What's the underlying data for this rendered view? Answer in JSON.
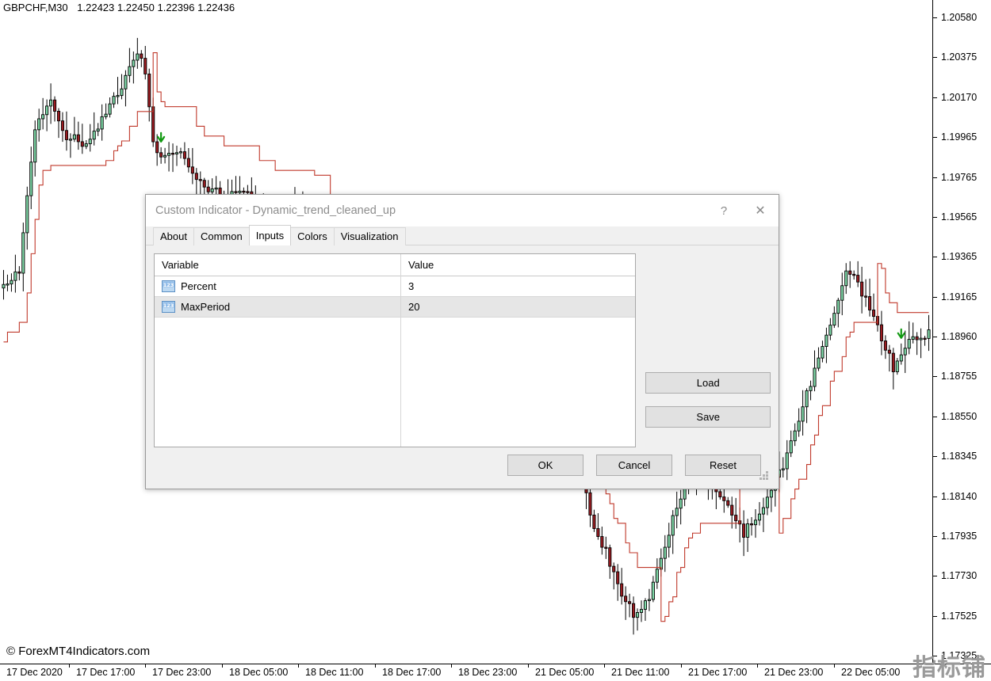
{
  "chart": {
    "symbol_header": "GBPCHF,M30",
    "ohlc": "1.22423 1.22450 1.22396 1.22436",
    "copyright": "© ForexMT4Indicators.com",
    "watermark": "指标铺",
    "colors": {
      "bull_body": "#7fd9a8",
      "bull_border": "#000000",
      "bear_body": "#9b1c21",
      "bear_border": "#000000",
      "indicator_line": "#c0392b",
      "arrow": "#119911",
      "axis": "#000000",
      "background": "#ffffff"
    },
    "price_axis": {
      "ticks": [
        "1.20580",
        "1.20375",
        "1.20170",
        "1.19965",
        "1.19765",
        "1.19565",
        "1.19365",
        "1.19165",
        "1.18960",
        "1.18755",
        "1.18550",
        "1.18345",
        "1.18140",
        "1.17935",
        "1.17730",
        "1.17525",
        "1.17325"
      ],
      "max": 1.2058,
      "min": 1.17325
    },
    "time_axis": {
      "ticks": [
        "17 Dec 2020",
        "17 Dec 17:00",
        "17 Dec 23:00",
        "18 Dec 05:00",
        "18 Dec 11:00",
        "18 Dec 17:00",
        "18 Dec 23:00",
        "21 Dec 05:00",
        "21 Dec 11:00",
        "21 Dec 17:00",
        "21 Dec 23:00",
        "22 Dec 05:00"
      ]
    }
  },
  "chart_data": {
    "type": "candlestick",
    "title": "GBPCHF,M30",
    "xlabel": "",
    "ylabel": "",
    "ylim": [
      1.17325,
      1.2058
    ],
    "series": [
      {
        "name": "Dynamic_trend_cleaned_up",
        "type": "step-line",
        "color": "#c0392b"
      }
    ]
  },
  "dialog": {
    "title": "Custom Indicator - Dynamic_trend_cleaned_up",
    "help_glyph": "?",
    "close_glyph": "✕",
    "tabs": [
      {
        "label": "About",
        "active": false
      },
      {
        "label": "Common",
        "active": false
      },
      {
        "label": "Inputs",
        "active": true
      },
      {
        "label": "Colors",
        "active": false
      },
      {
        "label": "Visualization",
        "active": false
      }
    ],
    "grid": {
      "headers": [
        "Variable",
        "Value"
      ],
      "rows": [
        {
          "icon": "number-type-icon",
          "variable": "Percent",
          "value": "3"
        },
        {
          "icon": "number-type-icon",
          "variable": "MaxPeriod",
          "value": "20"
        }
      ]
    },
    "side_buttons": [
      {
        "label": "Load"
      },
      {
        "label": "Save"
      }
    ],
    "footer_buttons": [
      {
        "label": "OK"
      },
      {
        "label": "Cancel"
      },
      {
        "label": "Reset"
      }
    ]
  }
}
